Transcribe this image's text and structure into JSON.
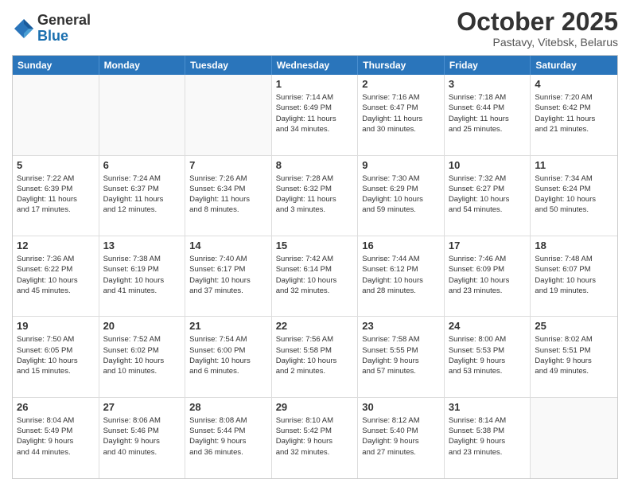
{
  "logo": {
    "general": "General",
    "blue": "Blue"
  },
  "header": {
    "month": "October 2025",
    "location": "Pastavy, Vitebsk, Belarus"
  },
  "days_of_week": [
    "Sunday",
    "Monday",
    "Tuesday",
    "Wednesday",
    "Thursday",
    "Friday",
    "Saturday"
  ],
  "weeks": [
    [
      {
        "day": "",
        "info": ""
      },
      {
        "day": "",
        "info": ""
      },
      {
        "day": "",
        "info": ""
      },
      {
        "day": "1",
        "info": "Sunrise: 7:14 AM\nSunset: 6:49 PM\nDaylight: 11 hours\nand 34 minutes."
      },
      {
        "day": "2",
        "info": "Sunrise: 7:16 AM\nSunset: 6:47 PM\nDaylight: 11 hours\nand 30 minutes."
      },
      {
        "day": "3",
        "info": "Sunrise: 7:18 AM\nSunset: 6:44 PM\nDaylight: 11 hours\nand 25 minutes."
      },
      {
        "day": "4",
        "info": "Sunrise: 7:20 AM\nSunset: 6:42 PM\nDaylight: 11 hours\nand 21 minutes."
      }
    ],
    [
      {
        "day": "5",
        "info": "Sunrise: 7:22 AM\nSunset: 6:39 PM\nDaylight: 11 hours\nand 17 minutes."
      },
      {
        "day": "6",
        "info": "Sunrise: 7:24 AM\nSunset: 6:37 PM\nDaylight: 11 hours\nand 12 minutes."
      },
      {
        "day": "7",
        "info": "Sunrise: 7:26 AM\nSunset: 6:34 PM\nDaylight: 11 hours\nand 8 minutes."
      },
      {
        "day": "8",
        "info": "Sunrise: 7:28 AM\nSunset: 6:32 PM\nDaylight: 11 hours\nand 3 minutes."
      },
      {
        "day": "9",
        "info": "Sunrise: 7:30 AM\nSunset: 6:29 PM\nDaylight: 10 hours\nand 59 minutes."
      },
      {
        "day": "10",
        "info": "Sunrise: 7:32 AM\nSunset: 6:27 PM\nDaylight: 10 hours\nand 54 minutes."
      },
      {
        "day": "11",
        "info": "Sunrise: 7:34 AM\nSunset: 6:24 PM\nDaylight: 10 hours\nand 50 minutes."
      }
    ],
    [
      {
        "day": "12",
        "info": "Sunrise: 7:36 AM\nSunset: 6:22 PM\nDaylight: 10 hours\nand 45 minutes."
      },
      {
        "day": "13",
        "info": "Sunrise: 7:38 AM\nSunset: 6:19 PM\nDaylight: 10 hours\nand 41 minutes."
      },
      {
        "day": "14",
        "info": "Sunrise: 7:40 AM\nSunset: 6:17 PM\nDaylight: 10 hours\nand 37 minutes."
      },
      {
        "day": "15",
        "info": "Sunrise: 7:42 AM\nSunset: 6:14 PM\nDaylight: 10 hours\nand 32 minutes."
      },
      {
        "day": "16",
        "info": "Sunrise: 7:44 AM\nSunset: 6:12 PM\nDaylight: 10 hours\nand 28 minutes."
      },
      {
        "day": "17",
        "info": "Sunrise: 7:46 AM\nSunset: 6:09 PM\nDaylight: 10 hours\nand 23 minutes."
      },
      {
        "day": "18",
        "info": "Sunrise: 7:48 AM\nSunset: 6:07 PM\nDaylight: 10 hours\nand 19 minutes."
      }
    ],
    [
      {
        "day": "19",
        "info": "Sunrise: 7:50 AM\nSunset: 6:05 PM\nDaylight: 10 hours\nand 15 minutes."
      },
      {
        "day": "20",
        "info": "Sunrise: 7:52 AM\nSunset: 6:02 PM\nDaylight: 10 hours\nand 10 minutes."
      },
      {
        "day": "21",
        "info": "Sunrise: 7:54 AM\nSunset: 6:00 PM\nDaylight: 10 hours\nand 6 minutes."
      },
      {
        "day": "22",
        "info": "Sunrise: 7:56 AM\nSunset: 5:58 PM\nDaylight: 10 hours\nand 2 minutes."
      },
      {
        "day": "23",
        "info": "Sunrise: 7:58 AM\nSunset: 5:55 PM\nDaylight: 9 hours\nand 57 minutes."
      },
      {
        "day": "24",
        "info": "Sunrise: 8:00 AM\nSunset: 5:53 PM\nDaylight: 9 hours\nand 53 minutes."
      },
      {
        "day": "25",
        "info": "Sunrise: 8:02 AM\nSunset: 5:51 PM\nDaylight: 9 hours\nand 49 minutes."
      }
    ],
    [
      {
        "day": "26",
        "info": "Sunrise: 8:04 AM\nSunset: 5:49 PM\nDaylight: 9 hours\nand 44 minutes."
      },
      {
        "day": "27",
        "info": "Sunrise: 8:06 AM\nSunset: 5:46 PM\nDaylight: 9 hours\nand 40 minutes."
      },
      {
        "day": "28",
        "info": "Sunrise: 8:08 AM\nSunset: 5:44 PM\nDaylight: 9 hours\nand 36 minutes."
      },
      {
        "day": "29",
        "info": "Sunrise: 8:10 AM\nSunset: 5:42 PM\nDaylight: 9 hours\nand 32 minutes."
      },
      {
        "day": "30",
        "info": "Sunrise: 8:12 AM\nSunset: 5:40 PM\nDaylight: 9 hours\nand 27 minutes."
      },
      {
        "day": "31",
        "info": "Sunrise: 8:14 AM\nSunset: 5:38 PM\nDaylight: 9 hours\nand 23 minutes."
      },
      {
        "day": "",
        "info": ""
      }
    ]
  ]
}
